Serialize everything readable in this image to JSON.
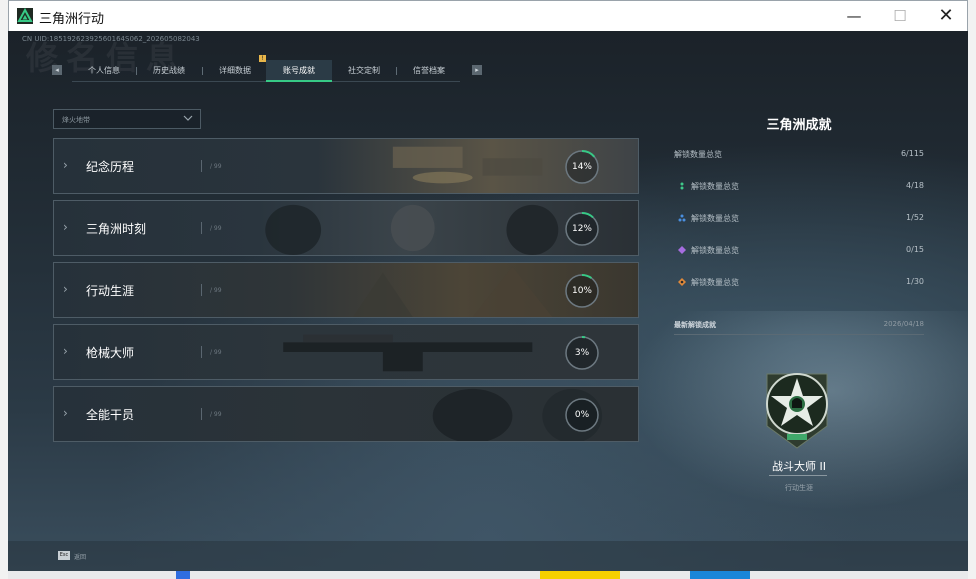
{
  "window": {
    "title": "三角洲行动",
    "min_icon": "—",
    "max_icon": "☐",
    "close_icon": "✕"
  },
  "header": {
    "uid": "CN UID:18519262392560164S062_202605082043",
    "ghost_heading": "修名信息"
  },
  "tabs": [
    {
      "label": "个人信息",
      "active": false
    },
    {
      "label": "历史战绩",
      "active": false
    },
    {
      "label": "详细数据",
      "active": false
    },
    {
      "label": "账号成就",
      "active": true
    },
    {
      "label": "社交定制",
      "active": false
    },
    {
      "label": "信誉档案",
      "active": false
    }
  ],
  "tab_nav": {
    "prev": "◂",
    "next": "▸",
    "badge": "!"
  },
  "filter": {
    "selected": "烽火地带"
  },
  "categories": [
    {
      "title": "纪念历程",
      "progress_pct": 14,
      "progress_label": "14%",
      "ghost": "/ 99"
    },
    {
      "title": "三角洲时刻",
      "progress_pct": 12,
      "progress_label": "12%",
      "ghost": "/ 99"
    },
    {
      "title": "行动生涯",
      "progress_pct": 10,
      "progress_label": "10%",
      "ghost": "/ 99"
    },
    {
      "title": "枪械大师",
      "progress_pct": 3,
      "progress_label": "3%",
      "ghost": "/ 99"
    },
    {
      "title": "全能干员",
      "progress_pct": 0,
      "progress_label": "0%",
      "ghost": "/ 99"
    }
  ],
  "summary": {
    "title": "三角洲成就",
    "total": {
      "label": "解锁数量总览",
      "value": "6/115"
    },
    "tiers": [
      {
        "label": "解锁数量总览",
        "value": "4/18",
        "icon": "green-tier-icon",
        "color": "#3fc98a"
      },
      {
        "label": "解锁数量总览",
        "value": "1/52",
        "icon": "blue-tier-icon",
        "color": "#4a8fe0"
      },
      {
        "label": "解锁数量总览",
        "value": "0/15",
        "icon": "purple-tier-icon",
        "color": "#a66de0"
      },
      {
        "label": "解锁数量总览",
        "value": "1/30",
        "icon": "gold-tier-icon",
        "color": "#e0893a"
      }
    ],
    "latest": {
      "label": "最新解锁成就",
      "date": "2026/04/18",
      "name": "战斗大师 II",
      "category": "行动生涯"
    }
  },
  "footer": {
    "esc_key": "Esc",
    "esc_label": "返回"
  },
  "colors": {
    "accent": "#37c986",
    "panel": "#1b2229"
  }
}
